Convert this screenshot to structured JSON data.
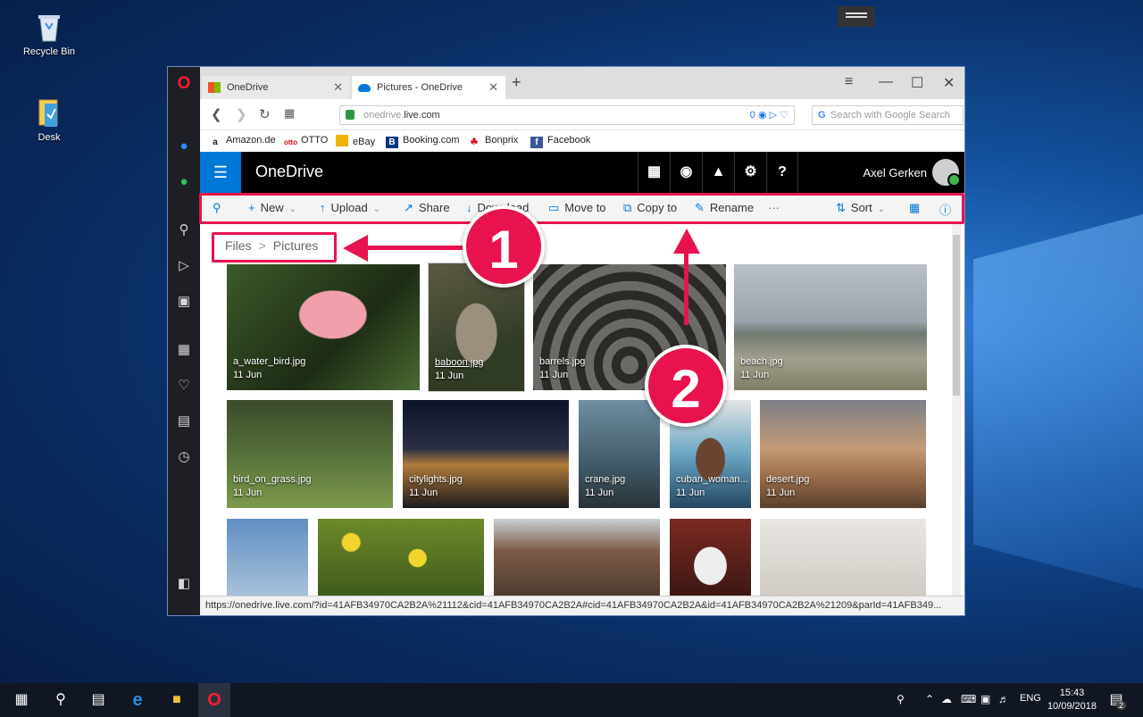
{
  "desktop": {
    "icons": [
      {
        "label": "Recycle Bin"
      },
      {
        "label": "Desk"
      }
    ]
  },
  "browser": {
    "tabs": [
      {
        "label": "OneDrive"
      },
      {
        "label": "Pictures - OneDrive"
      }
    ],
    "url_host": "live.com",
    "url_prefix": "onedrive.",
    "url_badge": "0",
    "search_placeholder": "Search with Google Search",
    "bookmarks": [
      "Amazon.de",
      "OTTO",
      "eBay",
      "Booking.com",
      "Bonprix",
      "Facebook"
    ],
    "status_url": "https://onedrive.live.com/?id=41AFB34970CA2B2A%21112&cid=41AFB34970CA2B2A#cid=41AFB34970CA2B2A&id=41AFB34970CA2B2A%21209&parId=41AFB349..."
  },
  "onedrive": {
    "title": "OneDrive",
    "user": "Axel Gerken",
    "commands": {
      "new": "New",
      "upload": "Upload",
      "share": "Share",
      "download": "Download",
      "move_to": "Move to",
      "copy_to": "Copy to",
      "rename": "Rename",
      "more": "···",
      "sort": "Sort"
    },
    "breadcrumb": {
      "root": "Files",
      "sep": ">",
      "current": "Pictures"
    },
    "files": [
      {
        "name": "a_water_bird.jpg",
        "date": "11 Jun"
      },
      {
        "name": "baboon.jpg",
        "date": "11 Jun"
      },
      {
        "name": "barrels.jpg",
        "date": "11 Jun"
      },
      {
        "name": "beach.jpg",
        "date": "11 Jun"
      },
      {
        "name": "bird_on_grass.jpg",
        "date": "11 Jun"
      },
      {
        "name": "citylights.jpg",
        "date": "11 Jun"
      },
      {
        "name": "crane.jpg",
        "date": "11 Jun"
      },
      {
        "name": "cuban_woman...",
        "date": "11 Jun"
      },
      {
        "name": "desert.jpg",
        "date": "11 Jun"
      }
    ]
  },
  "callouts": [
    "1",
    "2"
  ],
  "taskbar": {
    "language": "ENG",
    "time": "15:43",
    "date": "10/09/2018",
    "notifications": "2"
  },
  "colors": {
    "accent": "#0078d7",
    "highlight": "#e8134e",
    "taskbar": "#101622"
  }
}
